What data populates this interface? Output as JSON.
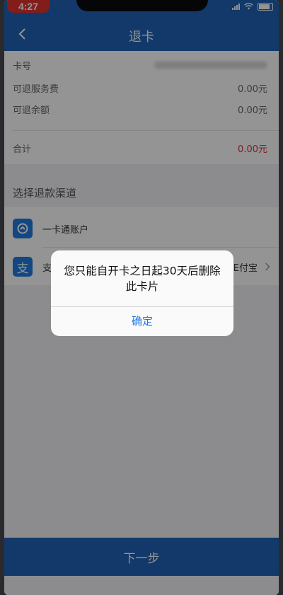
{
  "status_bar": {
    "time": "4:27"
  },
  "nav": {
    "title": "退卡"
  },
  "info": {
    "card_label": "卡号",
    "service_fee_label": "可退服务费",
    "service_fee_value": "0.00元",
    "balance_label": "可退余额",
    "balance_value": "0.00元",
    "total_label": "合计",
    "total_value": "0.00元"
  },
  "channels": {
    "title": "选择退款渠道",
    "items": [
      {
        "icon": "card-account-icon",
        "name": "一卡通账户",
        "right": ""
      },
      {
        "icon": "alipay-icon",
        "icon_glyph": "支",
        "name": "支",
        "right": "E付宝"
      }
    ]
  },
  "next_button": {
    "label": "下一步"
  },
  "dialog": {
    "message": "您只能自开卡之日起30天后删除此卡片",
    "confirm_label": "确定"
  },
  "colors": {
    "brand_blue": "#1f62b5",
    "accent_red": "#e0322f",
    "link_blue": "#1f7ae0"
  }
}
